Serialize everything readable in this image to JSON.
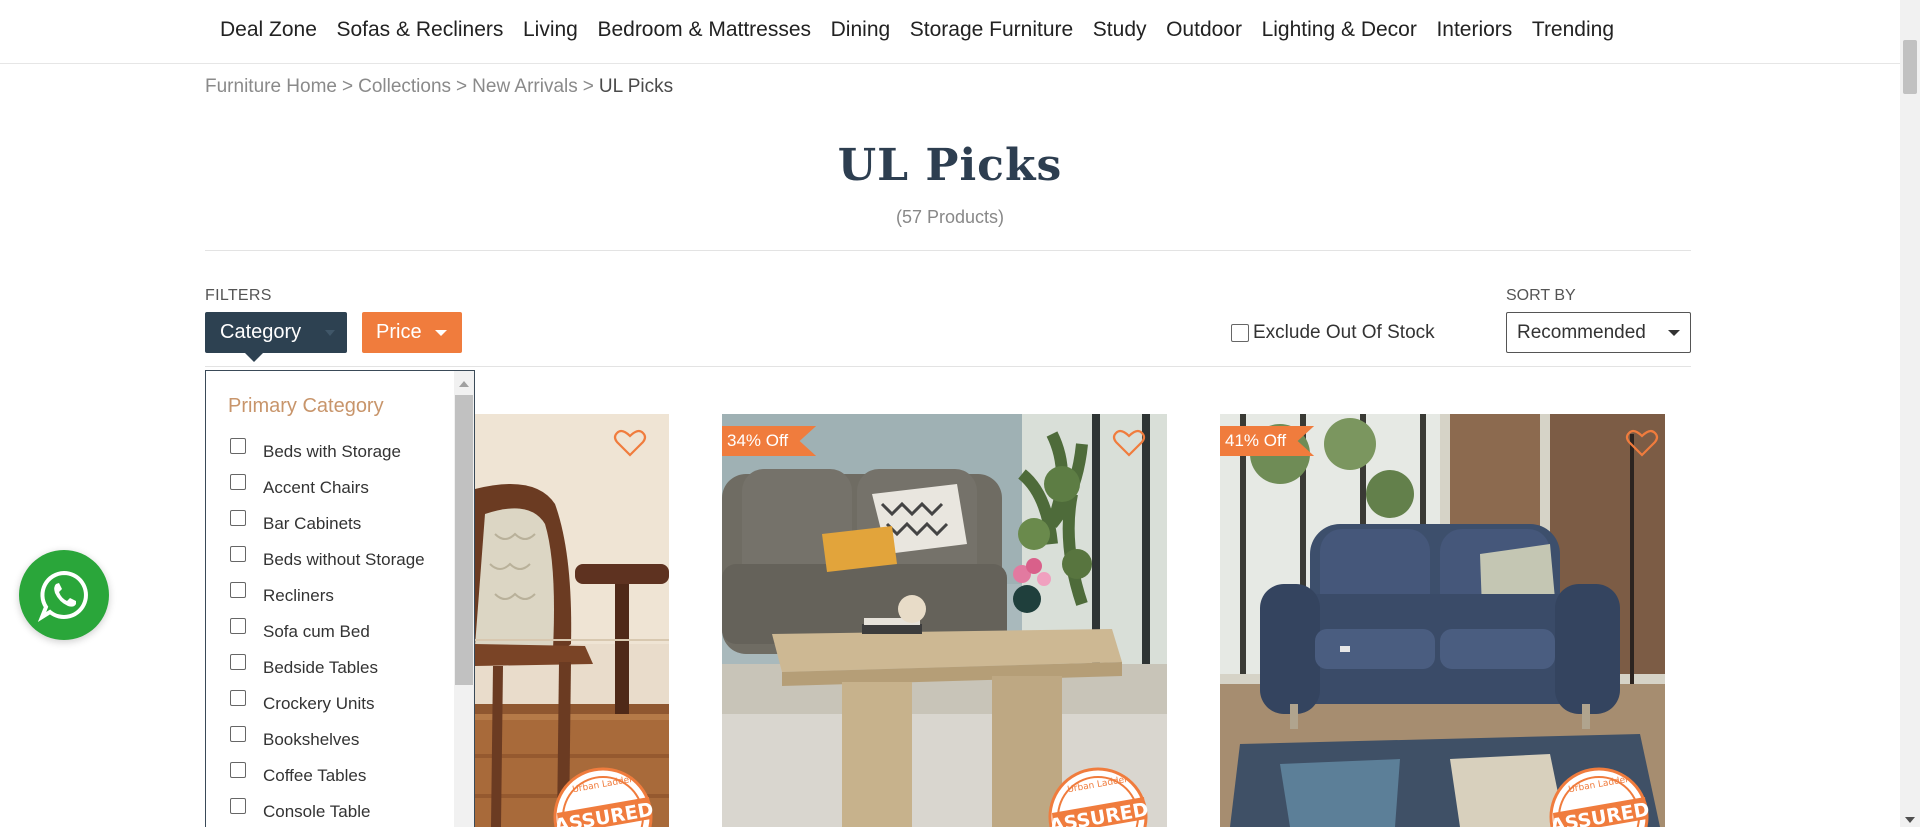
{
  "nav": {
    "items": [
      "Deal Zone",
      "Sofas & Recliners",
      "Living",
      "Bedroom & Mattresses",
      "Dining",
      "Storage Furniture",
      "Study",
      "Outdoor",
      "Lighting & Decor",
      "Interiors",
      "Trending"
    ]
  },
  "breadcrumb": {
    "items": [
      "Furniture Home",
      "Collections",
      "New Arrivals"
    ],
    "separator": ">",
    "current": "UL Picks"
  },
  "page": {
    "title": "UL Picks",
    "count": "(57 Products)"
  },
  "filters": {
    "label": "FILTERS",
    "category_label": "Category",
    "price_label": "Price",
    "exclude_label": "Exclude Out Of Stock",
    "exclude_checked": false,
    "accent_color": "#f07c3d",
    "category_color": "#2d4151"
  },
  "sort": {
    "label": "SORT BY",
    "value": "Recommended"
  },
  "category_dropdown": {
    "heading": "Primary Category",
    "options": [
      "Beds with Storage",
      "Accent Chairs",
      "Bar Cabinets",
      "Beds without Storage",
      "Recliners",
      "Sofa cum Bed",
      "Bedside Tables",
      "Crockery Units",
      "Bookshelves",
      "Coffee Tables",
      "Console Table"
    ]
  },
  "products": [
    {
      "badge": "",
      "image": "wooden-accent-chair-photo",
      "assured": "ASSURED"
    },
    {
      "badge": "34% Off",
      "image": "coffee-table-living-room-photo",
      "assured": "ASSURED"
    },
    {
      "badge": "41% Off",
      "image": "blue-recliner-sofa-photo",
      "assured": "ASSURED"
    }
  ],
  "assured_brand": "Urban Ladder",
  "whatsapp": {
    "icon": "whatsapp-icon",
    "color": "#2aa63a"
  }
}
